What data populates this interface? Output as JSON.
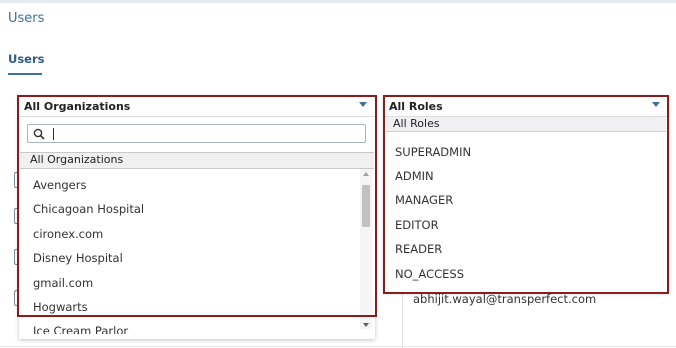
{
  "header": {
    "title": "Users"
  },
  "tabs": [
    {
      "label": "Users"
    }
  ],
  "background": {
    "visible_email": "abhijit.wayal@transperfect.com"
  },
  "org_dropdown": {
    "selected": "All Organizations",
    "search_placeholder": "",
    "options": [
      "All Organizations",
      "Avengers",
      "Chicagoan Hospital",
      "cironex.com",
      "Disney Hospital",
      "gmail.com",
      "Hogwarts",
      "Ice Cream Parlor"
    ]
  },
  "role_dropdown": {
    "selected": "All Roles",
    "options": [
      "All Roles",
      "SUPERADMIN",
      "ADMIN",
      "MANAGER",
      "EDITOR",
      "READER",
      "NO_ACCESS"
    ]
  },
  "colors": {
    "accent": "#3f6f9c",
    "highlight": "#8b1c1c"
  }
}
